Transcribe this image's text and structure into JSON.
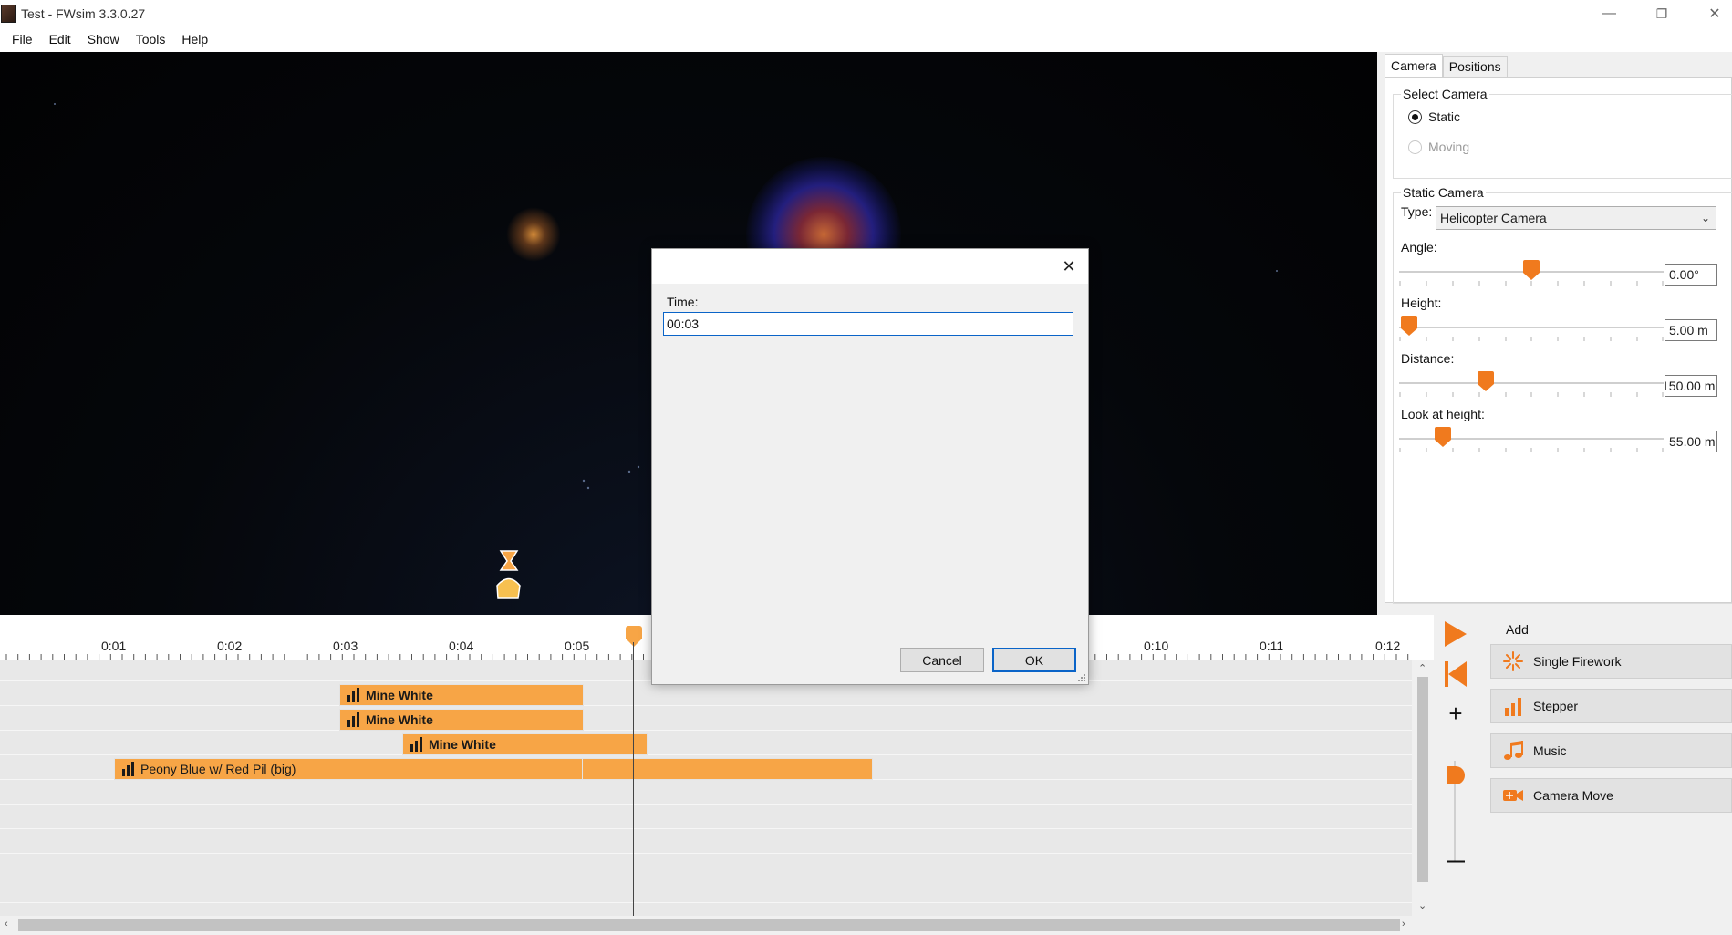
{
  "window": {
    "title": "Test - FWsim 3.3.0.27",
    "minimize_glyph": "—",
    "restore_glyph": "❐",
    "close_glyph": "✕"
  },
  "menu": [
    "File",
    "Edit",
    "Show",
    "Tools",
    "Help"
  ],
  "right_panel": {
    "tabs": [
      "Camera",
      "Positions"
    ],
    "active_tab": "Camera",
    "select_camera": {
      "title": "Select Camera",
      "options": [
        {
          "label": "Static",
          "checked": true,
          "disabled": false
        },
        {
          "label": "Moving",
          "checked": false,
          "disabled": true
        }
      ]
    },
    "static_camera": {
      "title": "Static Camera",
      "type_label": "Type:",
      "type_value": "Helicopter Camera",
      "sliders": [
        {
          "label": "Angle:",
          "value": "0.00°",
          "level": 0.5
        },
        {
          "label": "Height:",
          "value": "5.00 m",
          "level": 0.03
        },
        {
          "label": "Distance:",
          "value": "150.00 m",
          "level": 0.32
        },
        {
          "label": "Look at height:",
          "value": "55.00 m",
          "level": 0.16
        }
      ]
    }
  },
  "timeline": {
    "ruler_labels": [
      "0:01",
      "0:02",
      "0:03",
      "0:04",
      "0:05",
      "0:10",
      "0:11",
      "0:12"
    ],
    "events": [
      {
        "label": "Mine White",
        "bold": true
      },
      {
        "label": "Mine White",
        "bold": true
      },
      {
        "label": "Mine White",
        "bold": true
      },
      {
        "label": "Peony Blue w/ Red Pil (big)",
        "bold": false
      }
    ]
  },
  "controls": {
    "add_label": "Add",
    "zoom_in_glyph": "+",
    "zoom_out_glyph": "—",
    "add_buttons": [
      {
        "label": "Single Firework",
        "icon": "burst-icon"
      },
      {
        "label": "Stepper",
        "icon": "stepper-icon"
      },
      {
        "label": "Music",
        "icon": "music-note-icon"
      },
      {
        "label": "Camera Move",
        "icon": "camera-move-icon"
      }
    ]
  },
  "dialog": {
    "close_glyph": "✕",
    "time_label": "Time:",
    "time_value": "00:03",
    "cancel_label": "Cancel",
    "ok_label": "OK"
  },
  "colors": {
    "accent_orange": "#f07a1e",
    "event_orange": "#f7a546",
    "focus_blue": "#0a64c8"
  }
}
